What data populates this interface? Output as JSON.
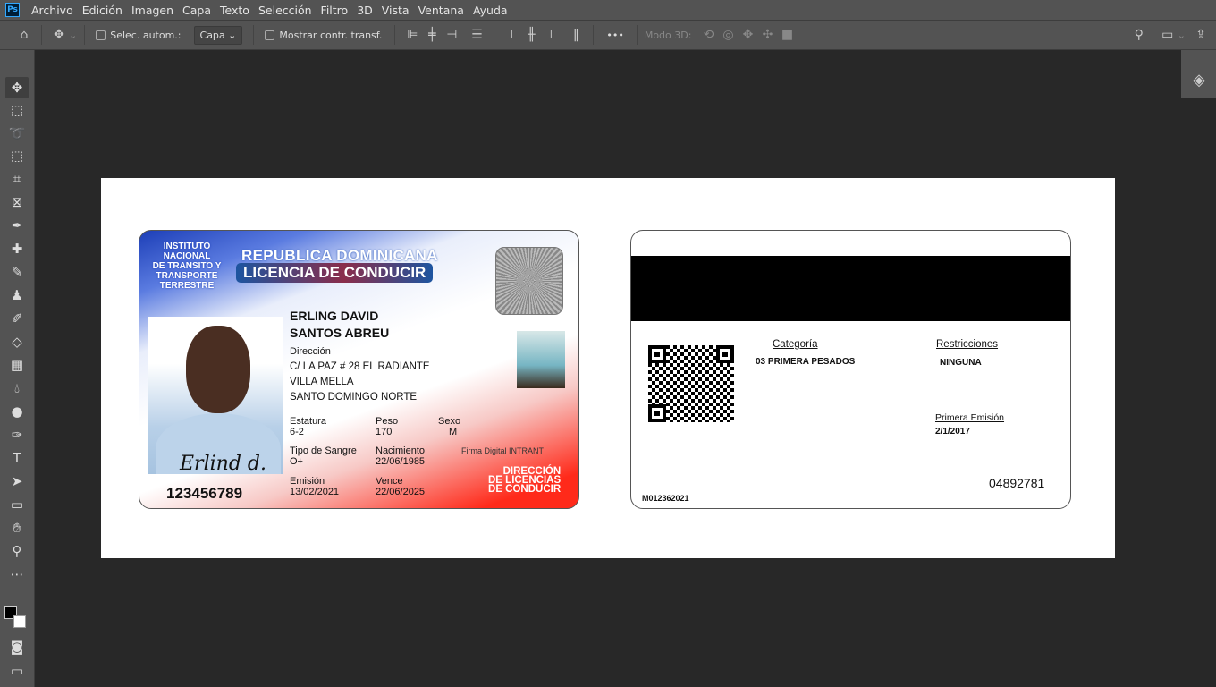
{
  "app": {
    "logo": "Ps",
    "menu": [
      "Archivo",
      "Edición",
      "Imagen",
      "Capa",
      "Texto",
      "Selección",
      "Filtro",
      "3D",
      "Vista",
      "Ventana",
      "Ayuda"
    ]
  },
  "options": {
    "auto_select_label": "Selec. autom.:",
    "layer_select": "Capa",
    "show_transform_label": "Mostrar contr. transf.",
    "more": "•••",
    "mode3d_label": "Modo 3D:"
  },
  "front": {
    "institute": [
      "INSTITUTO",
      "NACIONAL",
      "DE TRANSITO Y",
      "TRANSPORTE",
      "TERRESTRE"
    ],
    "country": "REPUBLICA DOMINICANA",
    "title": "LICENCIA DE CONDUCIR",
    "name1": "ERLING DAVID",
    "name2": "SANTOS ABREU",
    "address_label": "Dirección",
    "address": [
      "C/ LA PAZ # 28 EL RADIANTE",
      "VILLA MELLA",
      "SANTO DOMINGO NORTE"
    ],
    "height_label": "Estatura",
    "height": "6-2",
    "weight_label": "Peso",
    "weight": "170",
    "sex_label": "Sexo",
    "sex": "M",
    "blood_label": "Tipo de Sangre",
    "blood": "O+",
    "birth_label": "Nacimiento",
    "birth": "22/06/1985",
    "issue_label": "Emisión",
    "issue": "13/02/2021",
    "expiry_label": "Vence",
    "expiry": "22/06/2025",
    "signature_label": "Firma Digital INTRANT",
    "holder_signature": "Erlind d.",
    "license_number": "123456789",
    "department": [
      "DIRECCIÓN",
      "DE LICENCIAS",
      "DE CONDUCIR"
    ]
  },
  "back": {
    "category_label": "Categoría",
    "category": "03 PRIMERA PESADOS",
    "restrictions_label": "Restricciones",
    "restrictions": "NINGUNA",
    "first_issue_label": "Primera Emisión",
    "first_issue": "2/1/2017",
    "serial": "04892781",
    "code": "M012362021"
  }
}
